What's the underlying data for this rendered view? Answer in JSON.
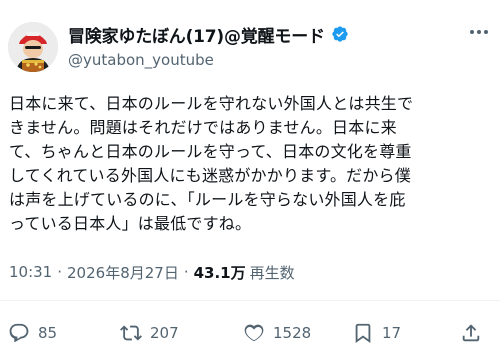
{
  "author": {
    "display_name": "冒険家ゆたぼん(17)@覚醒モード",
    "handle": "@yutabon_youtube",
    "avatar_icon": "avatar-photo",
    "verified_icon": "verified-badge-icon",
    "verified_color": "#1d9bf0"
  },
  "tweet": {
    "lines": [
      "日本に来て、日本のルールを守れない外国人とは共生で",
      "きません。問題はそれだけではありません。日本に来",
      "て、ちゃんと日本のルールを守って、日本の文化を尊重",
      "してくれている外国人にも迷惑がかかります。だから僕",
      "は声を上げているのに、「ルールを守らない外国人を庇",
      "っている日本人」は最低ですね。"
    ]
  },
  "meta": {
    "time": "10:31",
    "separator": "·",
    "date": "2026年8月27日",
    "views_count": "43.1万",
    "views_label": "再生数"
  },
  "actions": {
    "reply_count": "85",
    "retweet_count": "207",
    "like_count": "1528",
    "bookmark_count": "17"
  },
  "colors": {
    "text_primary": "#0f1419",
    "text_secondary": "#536471",
    "accent": "#1d9bf0"
  }
}
